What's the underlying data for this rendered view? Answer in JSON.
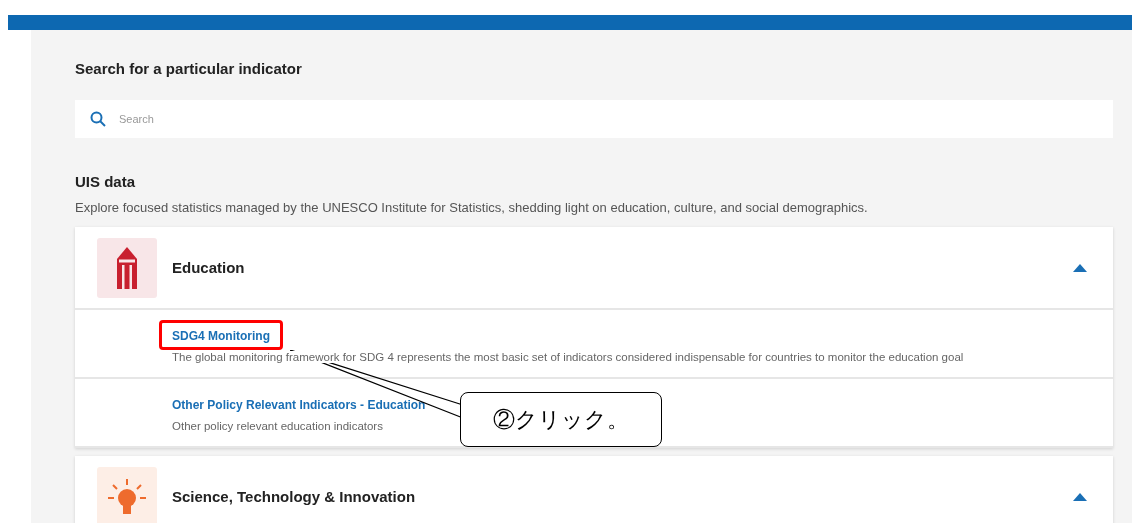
{
  "search_section": {
    "heading": "Search for a particular indicator",
    "search": {
      "placeholder": "Search"
    }
  },
  "uis_data": {
    "heading": "UIS data",
    "description": "Explore focused statistics managed by the UNESCO Institute for Statistics, shedding light on education, culture, and social demographics."
  },
  "categories": [
    {
      "kind": "education",
      "title": "Education",
      "expanded": true,
      "items": [
        {
          "title": "SDG4 Monitoring",
          "description": "The global monitoring framework for SDG 4 represents the most basic set of indicators considered indispensable for countries to monitor the education goal",
          "highlighted": true
        },
        {
          "title": "Other Policy Relevant Indicators - Education",
          "description": "Other policy relevant education indicators",
          "highlighted": false
        }
      ]
    },
    {
      "kind": "science",
      "title": "Science, Technology & Innovation",
      "expanded": true
    }
  ],
  "callout": {
    "text": "②クリック。"
  }
}
